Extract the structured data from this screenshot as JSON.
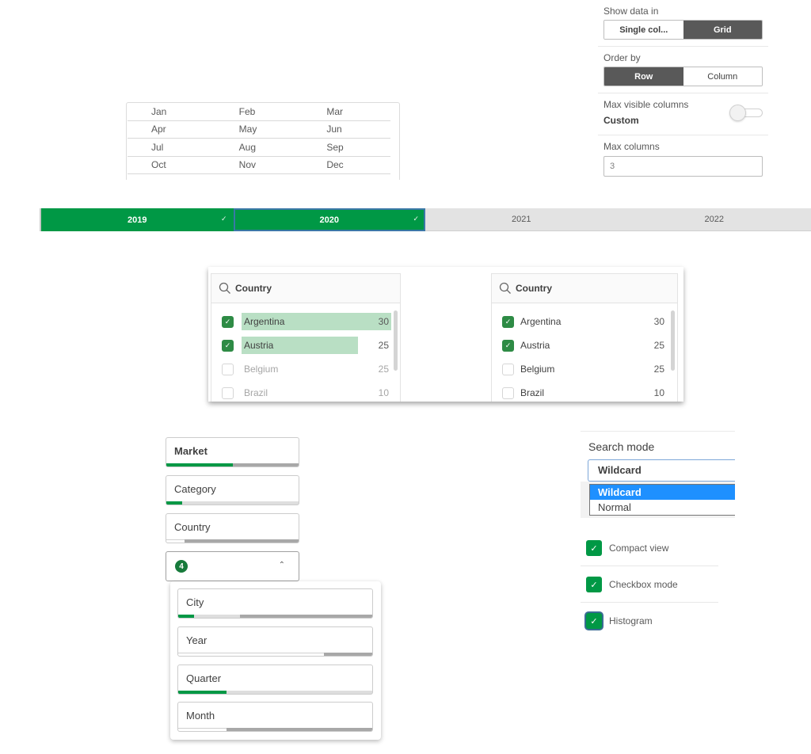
{
  "properties": {
    "show_data_in": {
      "label": "Show data in",
      "options": [
        "Single col...",
        "Grid"
      ],
      "selected": "Grid"
    },
    "order_by": {
      "label": "Order by",
      "options": [
        "Row",
        "Column"
      ],
      "selected": "Row"
    },
    "max_visible_columns": {
      "label": "Max visible columns",
      "value": "Custom",
      "toggle_on": false
    },
    "max_columns": {
      "label": "Max columns",
      "value": "3"
    }
  },
  "month_grid": {
    "rows": [
      [
        "Jan",
        "Feb",
        "Mar"
      ],
      [
        "Apr",
        "May",
        "Jun"
      ],
      [
        "Jul",
        "Aug",
        "Sep"
      ],
      [
        "Oct",
        "Nov",
        "Dec"
      ]
    ]
  },
  "year_bar": {
    "items": [
      {
        "label": "2019",
        "state": "selected",
        "check": "✓"
      },
      {
        "label": "2020",
        "state": "selected-focused",
        "check": "✓"
      },
      {
        "label": "2021",
        "state": "alternative"
      },
      {
        "label": "2022",
        "state": "alternative"
      }
    ]
  },
  "listbox_histogram": {
    "title": "Country",
    "items": [
      {
        "label": "Argentina",
        "count": "30",
        "checked": true,
        "histogram_fraction": 1.0
      },
      {
        "label": "Austria",
        "count": "25",
        "checked": true,
        "histogram_fraction": 0.78
      },
      {
        "label": "Belgium",
        "count": "25",
        "checked": false
      },
      {
        "label": "Brazil",
        "count": "10",
        "checked": false
      }
    ]
  },
  "listbox_plain": {
    "title": "Country",
    "items": [
      {
        "label": "Argentina",
        "count": "30",
        "checked": true
      },
      {
        "label": "Austria",
        "count": "25",
        "checked": true
      },
      {
        "label": "Belgium",
        "count": "25",
        "checked": false
      },
      {
        "label": "Brazil",
        "count": "10",
        "checked": false
      }
    ]
  },
  "filter_pane": {
    "items": [
      {
        "label": "Market",
        "selected_fraction": 0.5,
        "alternative_fraction": 0,
        "white_fraction": 0
      },
      {
        "label": "Category",
        "selected_fraction": 0.12,
        "alternative_fraction": 0.88,
        "white_fraction": 0
      },
      {
        "label": "Country",
        "selected_fraction": 0,
        "alternative_fraction": 0,
        "white_fraction": 0.14
      }
    ],
    "collapsed_count": "4",
    "collapsed_icon": "chevron-up-icon",
    "popover_items": [
      {
        "label": "City",
        "selected_fraction": 0.08,
        "alternative_fraction": 0.24,
        "white_fraction": 0
      },
      {
        "label": "Year",
        "selected_fraction": 0,
        "alternative_fraction": 0,
        "white_fraction": 0.75
      },
      {
        "label": "Quarter",
        "selected_fraction": 0.25,
        "alternative_fraction": 0.75,
        "white_fraction": 0
      },
      {
        "label": "Month",
        "selected_fraction": 0,
        "alternative_fraction": 0,
        "white_fraction": 0.25
      }
    ]
  },
  "search_settings": {
    "search_mode_label": "Search mode",
    "search_mode_value": "Wildcard",
    "search_mode_options": [
      "Wildcard",
      "Normal"
    ],
    "checkboxes": [
      {
        "label": "Compact view",
        "checked": true
      },
      {
        "label": "Checkbox mode",
        "checked": true
      },
      {
        "label": "Histogram",
        "checked": true
      }
    ]
  },
  "colors": {
    "selected_green": "#009845",
    "histogram_green": "#b9dfc4",
    "alternative_gray": "#e3e3e3",
    "excluded_gray": "#a8a8a8",
    "dropdown_highlight": "#1e90ff",
    "segment_active": "#595959"
  }
}
